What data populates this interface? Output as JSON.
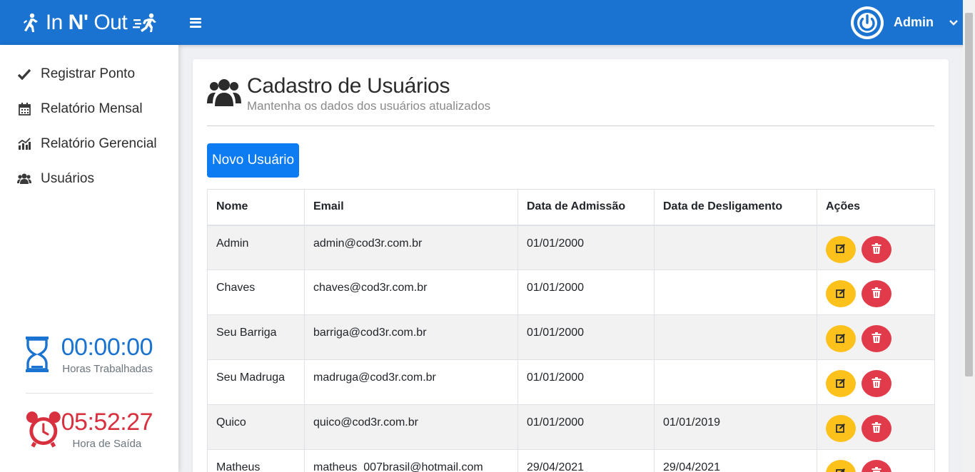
{
  "header": {
    "brand_prefix": "In ",
    "brand_bold": "N'",
    "brand_suffix": " Out",
    "user_name": "Admin"
  },
  "sidebar": {
    "items": [
      {
        "label": "Registrar Ponto",
        "icon": "check-icon"
      },
      {
        "label": "Relatório Mensal",
        "icon": "calendar-icon"
      },
      {
        "label": "Relatório Gerencial",
        "icon": "chart-icon"
      },
      {
        "label": "Usuários",
        "icon": "users-icon"
      }
    ],
    "worked_time": "00:00:00",
    "worked_label": "Horas Trabalhadas",
    "exit_time": "05:52:27",
    "exit_label": "Hora de Saída"
  },
  "page": {
    "title": "Cadastro de Usuários",
    "subtitle": "Mantenha os dados dos usuários atualizados",
    "new_button": "Novo Usuário"
  },
  "table": {
    "headers": [
      "Nome",
      "Email",
      "Data de Admissão",
      "Data de Desligamento",
      "Ações"
    ],
    "rows": [
      {
        "name": "Admin",
        "email": "admin@cod3r.com.br",
        "start": "01/01/2000",
        "end": ""
      },
      {
        "name": "Chaves",
        "email": "chaves@cod3r.com.br",
        "start": "01/01/2000",
        "end": ""
      },
      {
        "name": "Seu Barriga",
        "email": "barriga@cod3r.com.br",
        "start": "01/01/2000",
        "end": ""
      },
      {
        "name": "Seu Madruga",
        "email": "madruga@cod3r.com.br",
        "start": "01/01/2000",
        "end": ""
      },
      {
        "name": "Quico",
        "email": "quico@cod3r.com.br",
        "start": "01/01/2000",
        "end": "01/01/2019"
      },
      {
        "name": "Matheus",
        "email": "matheus_007brasil@hotmail.com",
        "start": "29/04/2021",
        "end": "29/04/2021"
      }
    ]
  },
  "colors": {
    "header": "#1a73d1",
    "primary": "#0d7cf2",
    "edit": "#fcc21b",
    "delete": "#e13b4b",
    "worked": "#1a73d1",
    "exit": "#d8303f"
  }
}
